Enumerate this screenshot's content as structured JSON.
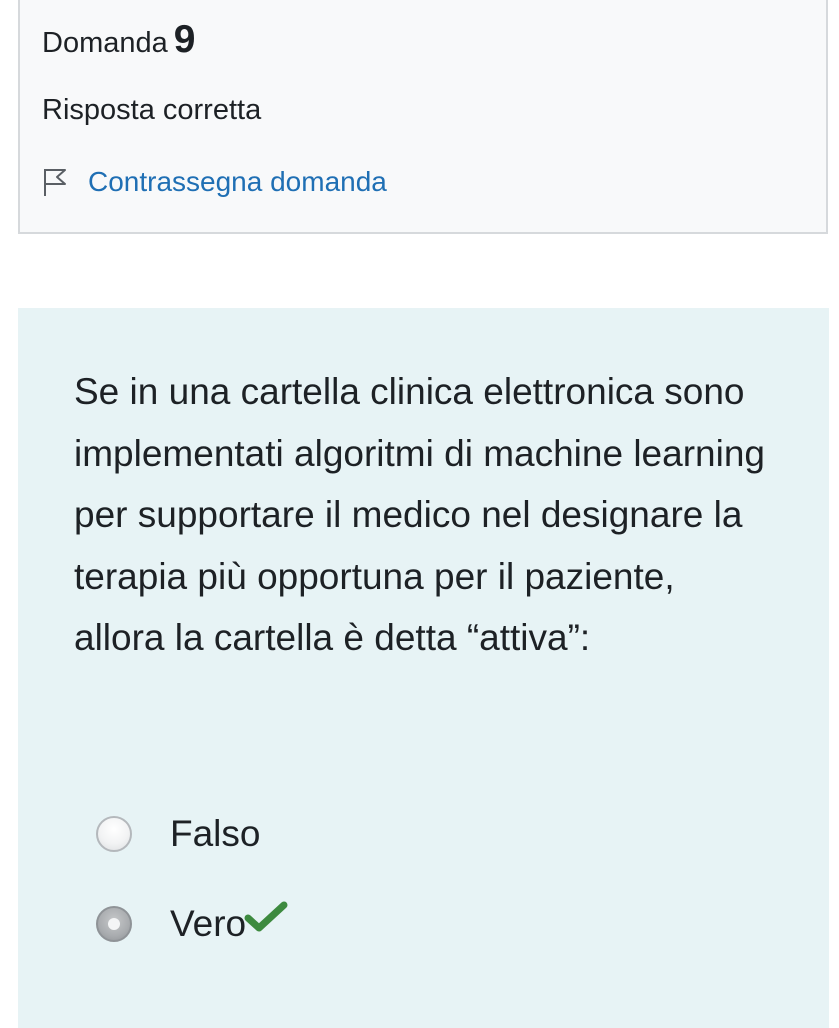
{
  "info": {
    "question_prefix": "Domanda",
    "question_number": "9",
    "state": "Risposta corretta",
    "flag_label": "Contrassegna domanda",
    "flag_icon": "flag-outline-icon"
  },
  "question": {
    "text": "Se in una cartella clinica elettronica sono implementati algoritmi di machine learning per supportare il medico nel designare la terapia più opportuna per il paziente, allora la cartella è detta “attiva”:"
  },
  "answers": [
    {
      "label": "Falso",
      "selected": false
    },
    {
      "label": "Vero",
      "selected": true,
      "mark": "checkmark-icon"
    }
  ],
  "colors": {
    "link": "#1f6fb4",
    "formulation_bg": "#e7f3f5",
    "correct": "#3d8a3f"
  }
}
